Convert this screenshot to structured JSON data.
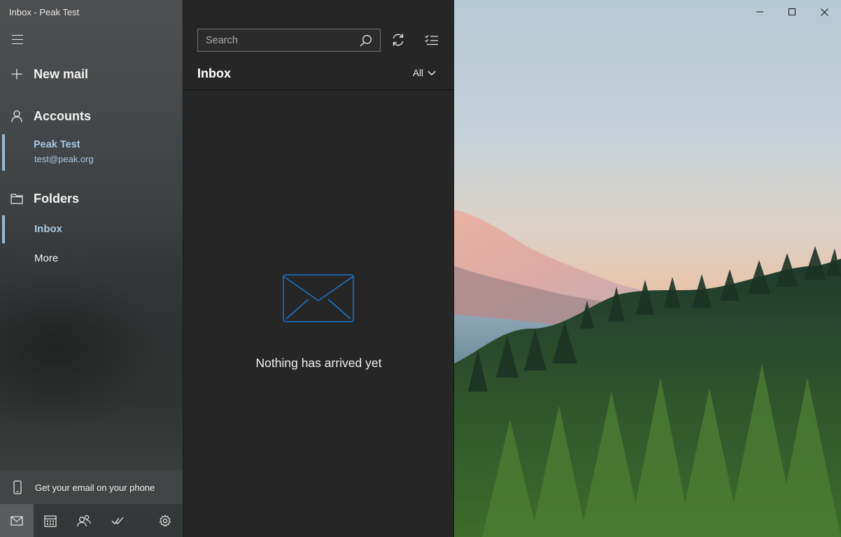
{
  "window": {
    "title": "Inbox - Peak Test",
    "controls": [
      "minimize",
      "maximize",
      "close"
    ]
  },
  "nav": {
    "new_mail": "New mail",
    "accounts_heading": "Accounts",
    "account": {
      "name": "Peak Test",
      "email": "test@peak.org"
    },
    "folders_heading": "Folders",
    "folders": [
      {
        "label": "Inbox",
        "selected": true
      },
      {
        "label": "More",
        "selected": false
      }
    ],
    "phone_promo": "Get your email on your phone",
    "bottom_icons": [
      "mail-icon",
      "calendar-icon",
      "people-icon",
      "todo-icon",
      "settings-icon"
    ]
  },
  "list": {
    "search_placeholder": "Search",
    "title": "Inbox",
    "filter": "All",
    "empty_message": "Nothing has arrived yet"
  },
  "colors": {
    "accent": "#a9c8e2",
    "envelope_accent": "#1a74c6",
    "list_bg": "#262626"
  }
}
